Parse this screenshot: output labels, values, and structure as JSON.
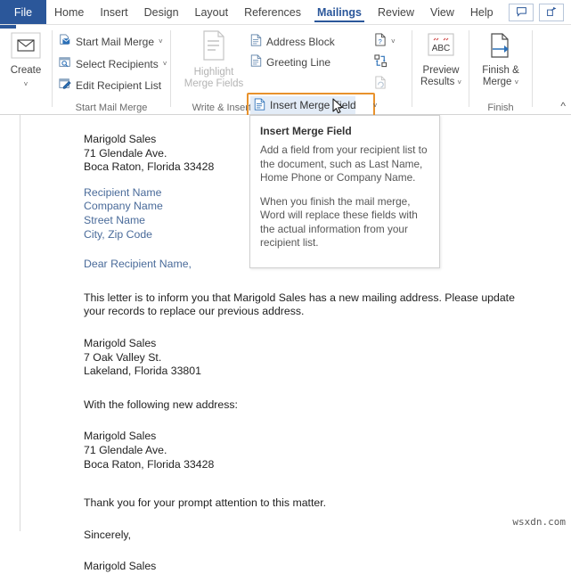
{
  "window": {
    "file_tab": "File",
    "tabs": [
      {
        "label": "Home",
        "active": false
      },
      {
        "label": "Insert",
        "active": false
      },
      {
        "label": "Design",
        "active": false
      },
      {
        "label": "Layout",
        "active": false
      },
      {
        "label": "References",
        "active": false
      },
      {
        "label": "Mailings",
        "active": true
      },
      {
        "label": "Review",
        "active": false
      },
      {
        "label": "View",
        "active": false
      },
      {
        "label": "Help",
        "active": false
      }
    ],
    "header_buttons": [
      {
        "name": "comments-icon",
        "glyph": "comment"
      },
      {
        "name": "share-icon",
        "glyph": "share"
      }
    ]
  },
  "ribbon": {
    "collapse_glyph": "^",
    "groups": [
      {
        "name": "create",
        "label": ""
      },
      {
        "name": "start-mail-merge",
        "label": "Start Mail Merge"
      },
      {
        "name": "write-insert-fields",
        "label": "Write & Insert Fields"
      },
      {
        "name": "preview-results",
        "label": ""
      },
      {
        "name": "finish",
        "label": "Finish"
      }
    ],
    "create_button": {
      "label": "Create",
      "icon": "envelope-icon",
      "chevron": "˅"
    },
    "start_mail_merge_items": [
      {
        "label": "Start Mail Merge",
        "icon": "start-mail-merge-icon",
        "chevron": "˅"
      },
      {
        "label": "Select Recipients",
        "icon": "select-recipients-icon",
        "chevron": "˅"
      },
      {
        "label": "Edit Recipient List",
        "icon": "edit-recipient-list-icon",
        "chevron": ""
      }
    ],
    "highlight_merge_fields": {
      "line1": "Highlight",
      "line2": "Merge Fields",
      "icon": "highlight-merge-fields-icon",
      "disabled": true
    },
    "write_insert_items": [
      {
        "label": "Address Block",
        "icon": "address-block-icon"
      },
      {
        "label": "Greeting Line",
        "icon": "greeting-line-icon"
      },
      {
        "label": "Insert Merge Field",
        "icon": "insert-merge-field-icon",
        "chevron": "˅",
        "highlighted": true,
        "hovered": true
      }
    ],
    "write_insert_extra": [
      {
        "name": "rules-icon",
        "chevron": "˅"
      },
      {
        "name": "match-fields-icon",
        "chevron": ""
      },
      {
        "name": "update-labels-icon",
        "chevron": "",
        "disabled": true
      }
    ],
    "preview_results": {
      "line1": "Preview",
      "line2": "Results",
      "icon": "preview-results-abc-icon",
      "icon_text": "ABC",
      "chevron": "˅"
    },
    "finish_merge": {
      "line1": "Finish &",
      "line2": "Merge",
      "icon": "finish-and-merge-icon",
      "chevron": "˅"
    }
  },
  "tooltip": {
    "title": "Insert Merge Field",
    "paragraph1": "Add a field from your recipient list to the document, such as Last Name, Home Phone or Company Name.",
    "paragraph2": "When you finish the mail merge, Word will replace these fields with the actual information from your recipient list."
  },
  "document": {
    "sender_block": [
      "Marigold Sales",
      "71 Glendale Ave.",
      "Boca Raton, Florida 33428"
    ],
    "merge_fields": [
      "Recipient Name",
      "Company Name",
      "Street Name",
      "City, Zip Code"
    ],
    "salutation": "Dear Recipient Name,",
    "body_paragraph": "This letter is to inform you that Marigold Sales has a new mailing address. Please update your records to replace our previous address.",
    "old_address": [
      "Marigold Sales",
      "7 Oak Valley St.",
      "Lakeland, Florida 33801"
    ],
    "new_address_intro": "With the following new address:",
    "new_address": [
      "Marigold Sales",
      "71 Glendale Ave.",
      "Boca Raton, Florida 33428"
    ],
    "closing_thanks": "Thank you for your prompt attention to this matter.",
    "closing_sincerely": "Sincerely,",
    "closing_signature": "Marigold Sales"
  },
  "watermark": "wsxdn.com",
  "colors": {
    "accent": "#2b579a",
    "highlight_border": "#e8922c",
    "merge_field_text": "#4a6b9a",
    "hover_bg": "#e3ecf7"
  }
}
